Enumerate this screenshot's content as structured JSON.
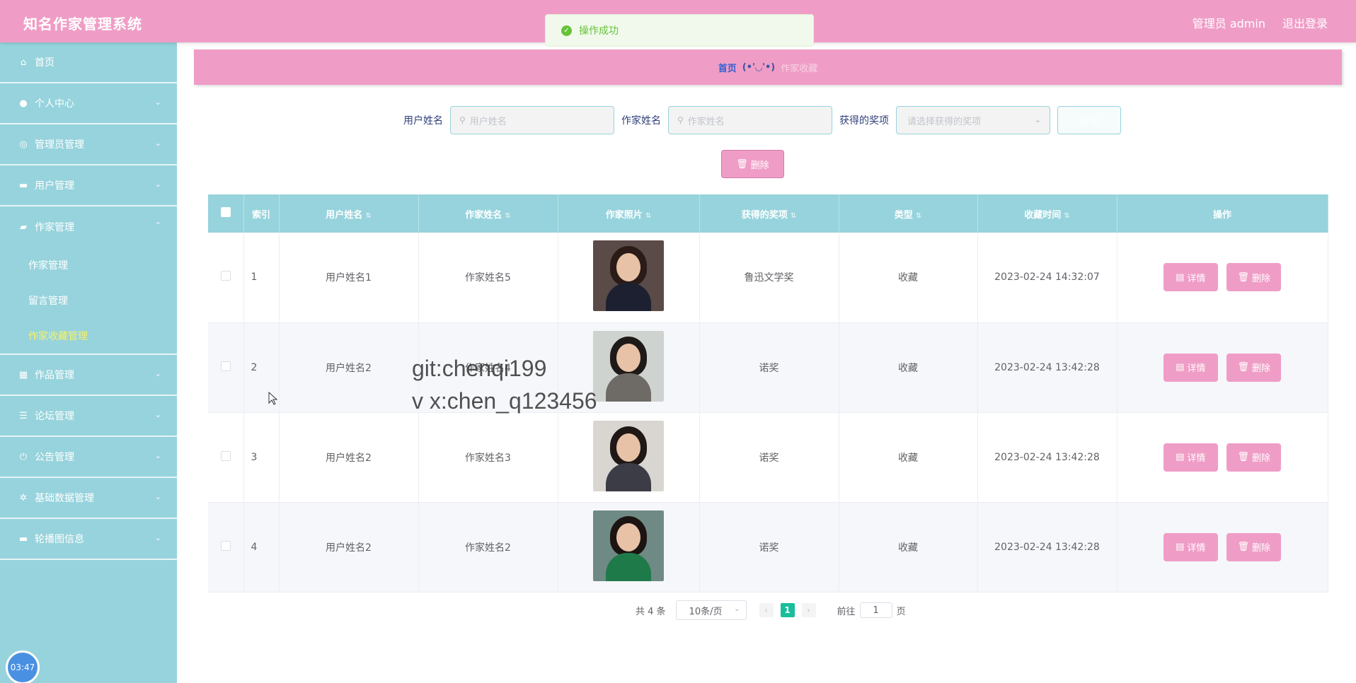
{
  "header": {
    "app_title": "知名作家管理系统",
    "user": "管理员 admin",
    "logout": "退出登录"
  },
  "toast": {
    "message": "操作成功"
  },
  "sidebar": {
    "items": [
      {
        "label": "首页",
        "icon": "home-icon",
        "glyph": "⌂"
      },
      {
        "label": "个人中心",
        "icon": "user-icon",
        "glyph": "●"
      },
      {
        "label": "管理员管理",
        "icon": "admin-icon",
        "glyph": "◎"
      },
      {
        "label": "用户管理",
        "icon": "users-icon",
        "glyph": "▬"
      },
      {
        "label": "作家管理",
        "icon": "briefcase-icon",
        "glyph": "▰"
      },
      {
        "label": "作品管理",
        "icon": "grid-icon",
        "glyph": "▦"
      },
      {
        "label": "论坛管理",
        "icon": "list-icon",
        "glyph": "☰"
      },
      {
        "label": "公告管理",
        "icon": "power-icon",
        "glyph": "⏻"
      },
      {
        "label": "基础数据管理",
        "icon": "settings-icon",
        "glyph": "✲"
      },
      {
        "label": "轮播图信息",
        "icon": "carousel-icon",
        "glyph": "▬"
      }
    ],
    "submenu": [
      {
        "label": "作家管理"
      },
      {
        "label": "留言管理"
      },
      {
        "label": "作家收藏管理"
      }
    ],
    "timer": "03:47"
  },
  "breadcrumb": {
    "home": "首页",
    "separator": "(•'◡'•)",
    "current": "作家收藏"
  },
  "search": {
    "user_label": "用户姓名",
    "user_placeholder": "用户姓名",
    "writer_label": "作家姓名",
    "writer_placeholder": "作家姓名",
    "award_label": "获得的奖项",
    "award_placeholder": "请选择获得的奖项",
    "query_button": "查询"
  },
  "toolbar": {
    "delete_label": "删除"
  },
  "table": {
    "headers": [
      "索引",
      "用户姓名",
      "作家姓名",
      "作家照片",
      "获得的奖项",
      "类型",
      "收藏时间",
      "操作"
    ],
    "rows": [
      {
        "index": "1",
        "user": "用户姓名1",
        "writer": "作家姓名5",
        "award": "鲁迅文学奖",
        "type": "收藏",
        "time": "2023-02-24 14:32:07"
      },
      {
        "index": "2",
        "user": "用户姓名2",
        "writer": "作家姓名4",
        "award": "诺奖",
        "type": "收藏",
        "time": "2023-02-24 13:42:28"
      },
      {
        "index": "3",
        "user": "用户姓名2",
        "writer": "作家姓名3",
        "award": "诺奖",
        "type": "收藏",
        "time": "2023-02-24 13:42:28"
      },
      {
        "index": "4",
        "user": "用户姓名2",
        "writer": "作家姓名2",
        "award": "诺奖",
        "type": "收藏",
        "time": "2023-02-24 13:42:28"
      }
    ],
    "detail_label": "详情",
    "delete_label": "删除"
  },
  "pagination": {
    "total": "共 4 条",
    "page_size": "10条/页",
    "current_page": "1",
    "goto_prefix": "前往",
    "goto_value": "1",
    "goto_suffix": "页"
  },
  "watermark": {
    "line1": "git:chenqi199",
    "line2": "v x:chen_q123456"
  }
}
